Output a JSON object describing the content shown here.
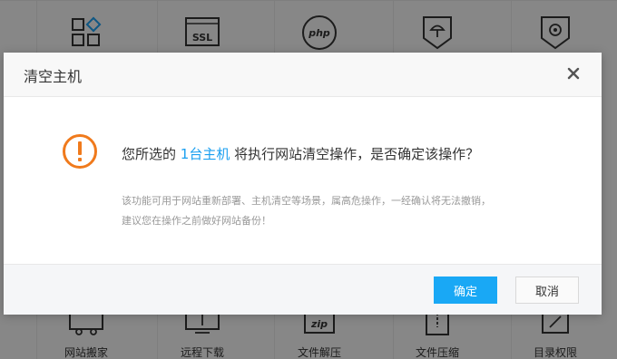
{
  "background_tools": {
    "top_row": [
      {
        "icon": "grid-icon",
        "label": ""
      },
      {
        "icon": "ssl-icon",
        "label": "",
        "icon_text": "SSL"
      },
      {
        "icon": "php-icon",
        "label": "",
        "icon_text": "php"
      },
      {
        "icon": "umbrella-shield-icon",
        "label": ""
      },
      {
        "icon": "gear-shield-icon",
        "label": ""
      }
    ],
    "bottom_row": [
      {
        "icon": "truck-icon",
        "label": "网站搬家"
      },
      {
        "icon": "download-icon",
        "label": "远程下载"
      },
      {
        "icon": "zip-icon",
        "label": "文件解压",
        "icon_text": "zip"
      },
      {
        "icon": "archive-icon",
        "label": "文件压缩"
      },
      {
        "icon": "folder-permission-icon",
        "label": "目录权限"
      }
    ]
  },
  "dialog": {
    "title": "清空主机",
    "question_before": "您所选的 ",
    "question_highlight": "1台主机",
    "question_after": " 将执行网站清空操作，是否确定该操作？",
    "note_line1": "该功能可用于网站重新部署、主机清空等场景，属高危操作，一经确认将无法撤销，",
    "note_line2": "建议您在操作之前做好网站备份！",
    "confirm_label": "确定",
    "cancel_label": "取消"
  },
  "colors": {
    "accent": "#19a8f5",
    "highlight": "#1a9ff0",
    "warning": "#f07a1c"
  }
}
